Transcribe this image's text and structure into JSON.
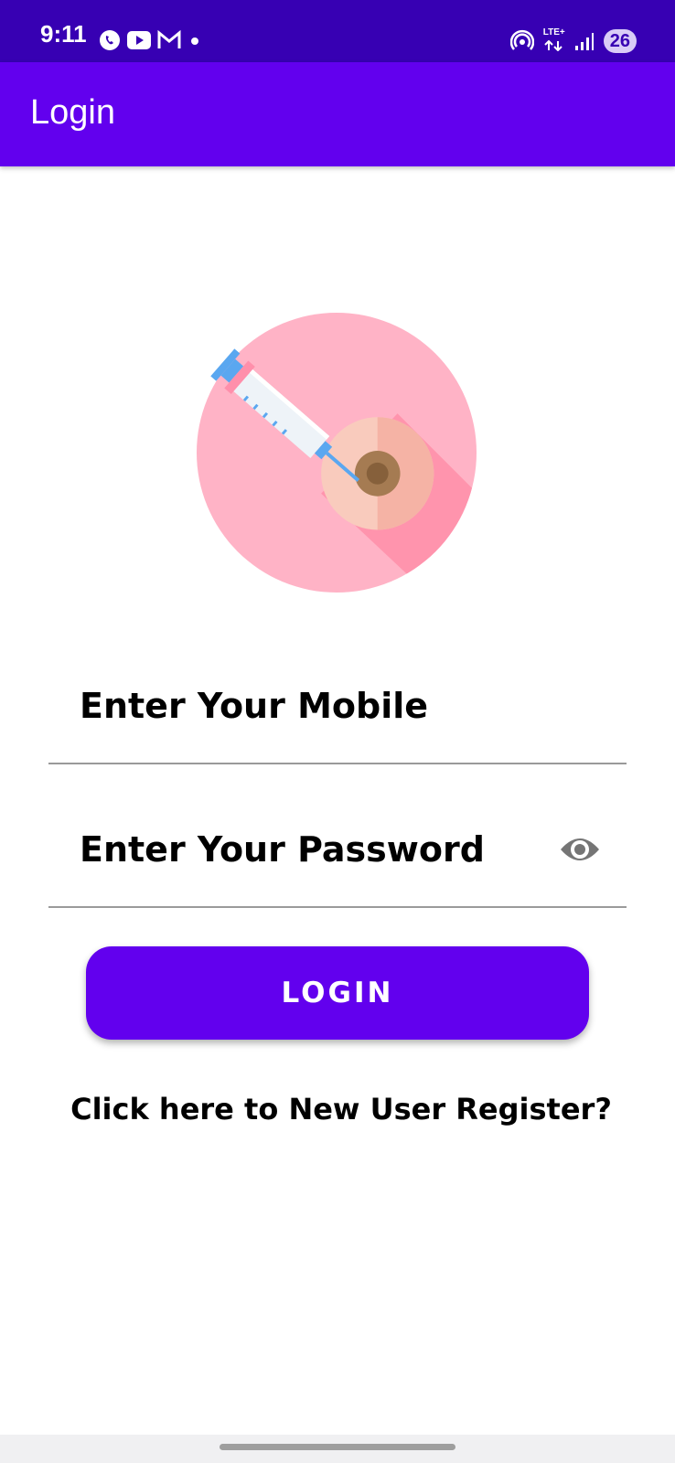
{
  "status_bar": {
    "time": "9:11",
    "notification_icons": [
      "viber-icon",
      "youtube-icon",
      "gmail-icon",
      "dot-icon"
    ],
    "network_label": "LTE+",
    "battery": "26",
    "colors": {
      "background": "#3700b3"
    }
  },
  "app_bar": {
    "title": "Login",
    "color": "#6200ee"
  },
  "logo": {
    "icon": "vaccine-syringe-icon"
  },
  "form": {
    "mobile_placeholder": "Enter Your Mobile",
    "password_placeholder": "Enter Your Password",
    "password_toggle_icon": "eye-icon",
    "login_label": "LOGIN",
    "login_color": "#6200ee"
  },
  "register_link": "Click here to New User Register?"
}
